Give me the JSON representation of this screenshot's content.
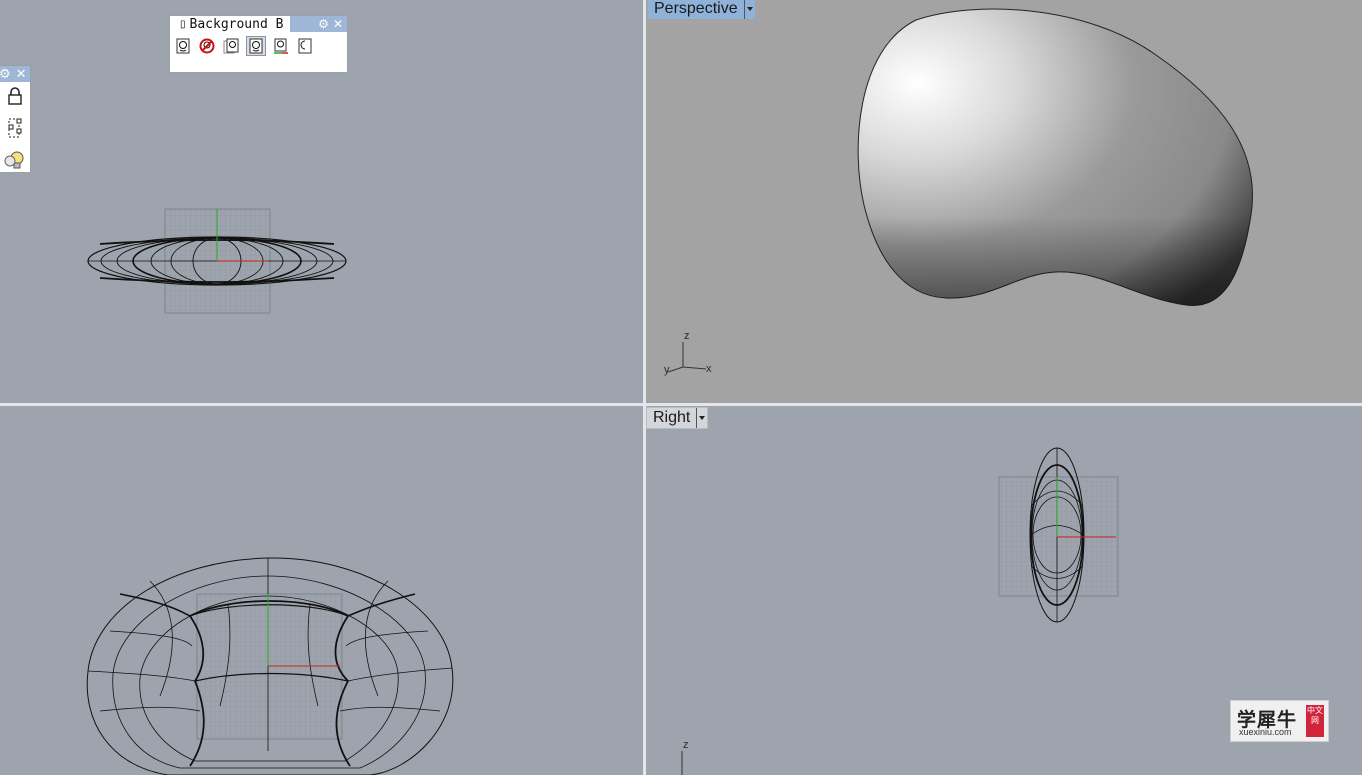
{
  "viewports": {
    "perspective": {
      "title": "Perspective"
    },
    "right": {
      "title": "Right"
    }
  },
  "background_panel": {
    "tab_title": "Background B",
    "tools": [
      "face-icon",
      "face-hidden-icon",
      "face-place-icon",
      "face-active-icon",
      "face-move-icon",
      "face-half-icon"
    ]
  },
  "layer_panel": {
    "tools": [
      "lock-icon",
      "group-icon",
      "bulb-icon"
    ]
  },
  "axes": {
    "x": "x",
    "y": "y",
    "z": "z"
  },
  "watermark": {
    "brand": "学犀牛",
    "site": "xuexiniu.com",
    "badge": "中文网"
  },
  "colors": {
    "viewport_bg": "#9ea4ad",
    "perspective_bg": "#a3a3a3",
    "active_tab": "#8fb2d9",
    "axis_x": "#cc2222",
    "axis_y": "#22aa22"
  }
}
